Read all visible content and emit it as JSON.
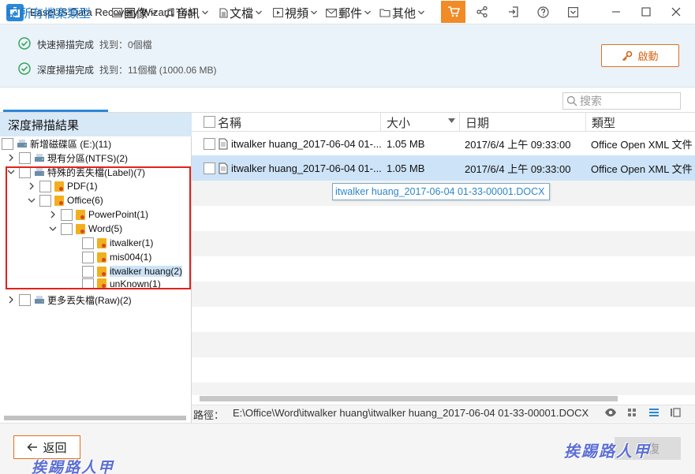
{
  "window": {
    "title": "EaseUS Data Recovery Wizard Trial",
    "icons": [
      "app-icon",
      "cart-icon",
      "share-icon",
      "sign-in-icon",
      "help-icon",
      "menu-dropdown-icon",
      "minimize-icon",
      "maximize-icon",
      "close-icon"
    ]
  },
  "scan_status": {
    "quick": {
      "label": "快速掃描完成",
      "count": "找到：0個檔"
    },
    "deep": {
      "label": "深度掃描完成",
      "count": "找到：11個檔 (1000.06 MB)"
    },
    "start_button": "啟動"
  },
  "filters": {
    "all": "所有檔案類型",
    "image": "圖像",
    "audio": "音訊",
    "document": "文檔",
    "video": "視頻",
    "email": "郵件",
    "other": "其他",
    "search_placeholder": "搜索"
  },
  "tree": {
    "header": "深度掃描結果",
    "nodes": [
      {
        "label": "新增磁碟區 (E:)(11)"
      },
      {
        "label": "現有分區(NTFS)(2)"
      },
      {
        "label": "特殊的丟失檔(Label)(7)"
      },
      {
        "label": "PDF(1)"
      },
      {
        "label": "Office(6)"
      },
      {
        "label": "PowerPoint(1)"
      },
      {
        "label": "Word(5)"
      },
      {
        "label": "itwalker(1)"
      },
      {
        "label": "mis004(1)"
      },
      {
        "label": "itwalker huang(2)"
      },
      {
        "label": "unKnown(1)"
      },
      {
        "label": "更多丟失檔(Raw)(2)"
      }
    ]
  },
  "file_list": {
    "columns": {
      "name": "名稱",
      "size": "大小",
      "date": "日期",
      "type": "類型"
    },
    "rows": [
      {
        "name": "itwalker huang_2017-06-04 01-...",
        "size": "1.05 MB",
        "date": "2017/6/4 上午 09:33:00",
        "type": "Office Open XML 文件"
      },
      {
        "name": "itwalker huang_2017-06-04 01-...",
        "size": "1.05 MB",
        "date": "2017/6/4 上午 09:33:00",
        "type": "Office Open XML 文件"
      }
    ],
    "tooltip": "itwalker huang_2017-06-04 01-33-00001.DOCX"
  },
  "path_bar": {
    "label": "路徑：",
    "value": "E:\\Office\\Word\\itwalker huang\\itwalker huang_2017-06-04 01-33-00001.DOCX",
    "view_icons": [
      "preview-eye-icon",
      "thumbnail-view-icon",
      "list-view-icon",
      "detail-view-icon"
    ]
  },
  "footer": {
    "back_button": "返回",
    "recover_button": "恢復",
    "watermark": "挨踢路人甲"
  },
  "colors": {
    "accent_blue": "#2b88d8",
    "status_bg": "#eaf3fa",
    "orange": "#f28a25",
    "highlight_red": "#e0221b",
    "selected_row": "#cde3f7"
  }
}
